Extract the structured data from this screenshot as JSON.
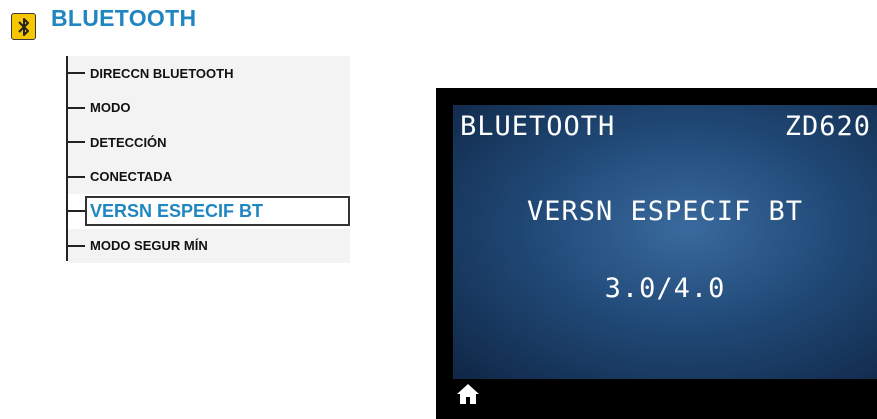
{
  "header": {
    "title": "BLUETOOTH",
    "icon": "bluetooth-icon"
  },
  "menu": {
    "items": [
      {
        "label": "DIRECCN BLUETOOTH"
      },
      {
        "label": "MODO"
      },
      {
        "label": "DETECCIÓN"
      },
      {
        "label": "CONECTADA"
      },
      {
        "label": "VERSN ESPECIF BT",
        "selected": true
      },
      {
        "label": "MODO SEGUR MÍN"
      }
    ]
  },
  "display": {
    "title": "BLUETOOTH",
    "model": "ZD620",
    "setting": "VERSN ESPECIF BT",
    "value": "3.0/4.0",
    "footer_icon": "home-icon"
  },
  "colors": {
    "accent": "#1f86c2",
    "icon_bg": "#f7c600",
    "screen_bg": "#214a78"
  }
}
